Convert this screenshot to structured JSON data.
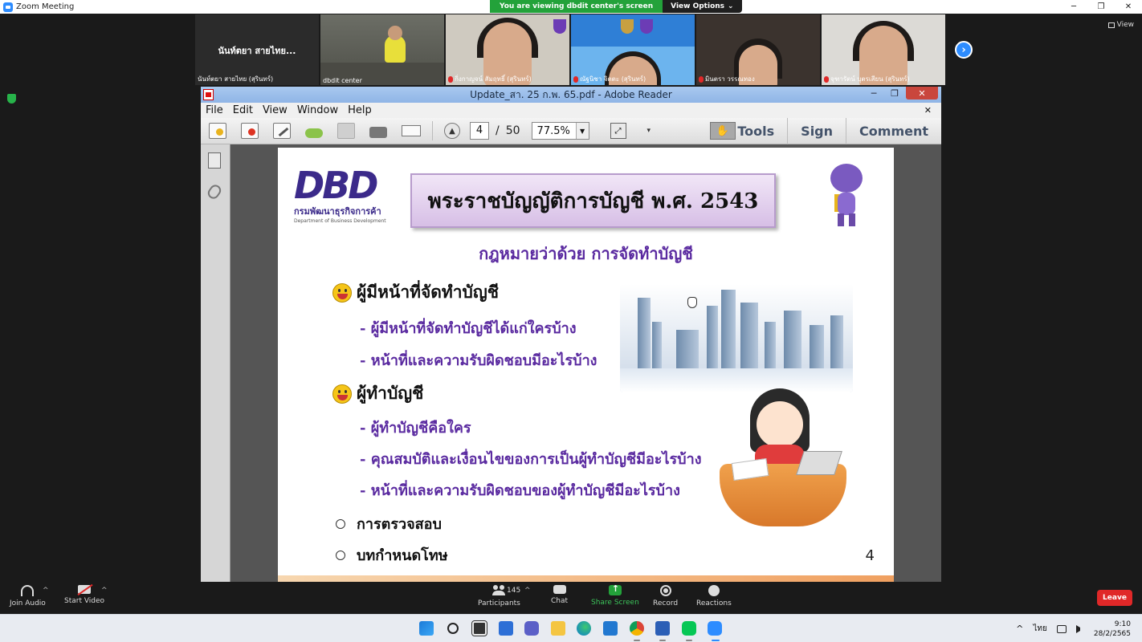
{
  "zoom": {
    "window_title": "Zoom Meeting",
    "share_banner": "You are viewing dbdit center's screen",
    "view_options": "View Options",
    "view_label": "View",
    "participants": [
      {
        "label": "นันท์ตยา สายไทย (สุรินทร์)",
        "big_name": "นันท์ตยา สายไทย..."
      },
      {
        "label": "dbdit center"
      },
      {
        "label": "กิ่งกาญจน์ สัมฤทธิ์ (สุรินทร์)"
      },
      {
        "label": "ณัฐนิชา จิตตะ (สุรินทร์)"
      },
      {
        "label": "มินตรา วรรณทอง"
      },
      {
        "label": "จุฑารัตน์ บุตรเสียน (สุรินทร์)"
      }
    ],
    "controls": {
      "join_audio": "Join Audio",
      "start_video": "Start Video",
      "participants": "Participants",
      "participant_count": "145",
      "chat": "Chat",
      "share_screen": "Share Screen",
      "record": "Record",
      "reactions": "Reactions",
      "leave": "Leave"
    }
  },
  "reader": {
    "title": "Update_สา. 25 ก.พ. 65.pdf - Adobe Reader",
    "menu": [
      "File",
      "Edit",
      "View",
      "Window",
      "Help"
    ],
    "page_current": "4",
    "page_sep": "/",
    "page_total": "50",
    "zoom": "77.5%",
    "right_tabs": [
      "Tools",
      "Sign",
      "Comment"
    ]
  },
  "slide": {
    "logo_mark": "DBD",
    "logo_thai": "กรมพัฒนาธุรกิจการค้า",
    "logo_en": "Department of Business Development",
    "title": "พระราชบัญญัติการบัญชี พ.ศ. 2543",
    "subtitle": "กฎหมายว่าด้วย การจัดทำบัญชี",
    "section1": "ผู้มีหน้าที่จัดทำบัญชี",
    "section1_items": [
      "- ผู้มีหน้าที่จัดทำบัญชีได้แก่ใครบ้าง",
      "- หน้าที่และความรับผิดชอบมีอะไรบ้าง"
    ],
    "section2": "ผู้ทำบัญชี",
    "section2_items": [
      "- ผู้ทำบัญชีคือใคร",
      "- คุณสมบัติและเงื่อนไขของการเป็นผู้ทำบัญชีมีอะไรบ้าง",
      "- หน้าที่และความรับผิดชอบของผู้ทำบัญชีมีอะไรบ้าง"
    ],
    "circle_items": [
      "การตรวจสอบ",
      "บทกำหนดโทษ"
    ],
    "page_number": "4"
  },
  "taskbar": {
    "time": "9:10",
    "date": "28/2/2565",
    "lang": "ไทย"
  }
}
